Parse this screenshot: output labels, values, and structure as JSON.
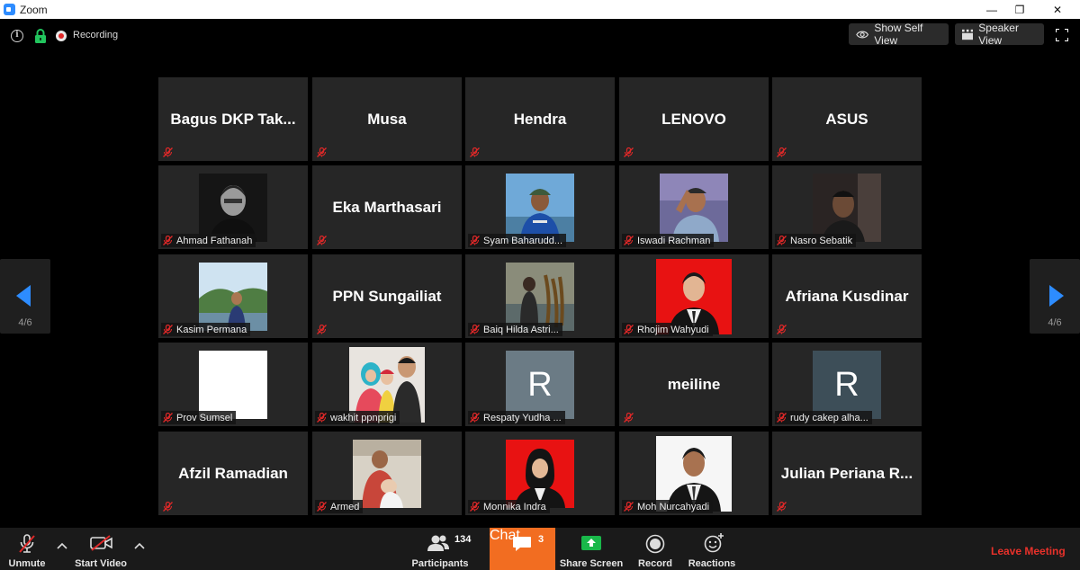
{
  "window": {
    "app_title": "Zoom",
    "minimize": "—",
    "maximize": "❐",
    "close": "✕"
  },
  "topbar": {
    "recording_label": "Recording",
    "show_self_view": "Show Self View",
    "speaker_view": "Speaker View"
  },
  "tiles": [
    {
      "name": "Bagus  DKP  Tak...",
      "kind": "text"
    },
    {
      "name": "Musa",
      "kind": "text"
    },
    {
      "name": "Hendra",
      "kind": "text"
    },
    {
      "name": "LENOVO",
      "kind": "text"
    },
    {
      "name": "ASUS",
      "kind": "text"
    },
    {
      "name": "Ahmad Fathanah",
      "kind": "photo"
    },
    {
      "name": "Eka Marthasari",
      "kind": "text"
    },
    {
      "name": "Syam Baharudd...",
      "kind": "photo"
    },
    {
      "name": "Iswadi Rachman",
      "kind": "photo"
    },
    {
      "name": "Nasro Sebatik",
      "kind": "photo"
    },
    {
      "name": "Kasim Permana",
      "kind": "photo"
    },
    {
      "name": "PPN Sungailiat",
      "kind": "text"
    },
    {
      "name": "Baiq Hilda Astri...",
      "kind": "photo"
    },
    {
      "name": "Rhojim Wahyudi",
      "kind": "photo"
    },
    {
      "name": "Afriana Kusdinar",
      "kind": "text"
    },
    {
      "name": "Prov Sumsel",
      "kind": "photo"
    },
    {
      "name": "wakhit ppnprigi",
      "kind": "photo"
    },
    {
      "name": "Respaty Yudha ...",
      "kind": "avatar",
      "letter": "R"
    },
    {
      "name": "meiline",
      "kind": "text"
    },
    {
      "name": "rudy cakep alha...",
      "kind": "avatar",
      "letter": "R"
    },
    {
      "name": "Afzil Ramadian",
      "kind": "text"
    },
    {
      "name": "Armed",
      "kind": "photo"
    },
    {
      "name": "Monnika Indra",
      "kind": "photo"
    },
    {
      "name": "Moh Nurcahyadi",
      "kind": "photo"
    },
    {
      "name": "Julian  Periana  R...",
      "kind": "text"
    }
  ],
  "pager": {
    "left": "4/6",
    "right": "4/6"
  },
  "toolbar": {
    "unmute": "Unmute",
    "start_video": "Start Video",
    "participants": "Participants",
    "participants_count": "134",
    "chat": "Chat",
    "chat_count": "3",
    "share_screen": "Share Screen",
    "record": "Record",
    "reactions": "Reactions",
    "leave": "Leave Meeting"
  },
  "colors": {
    "accent_chat": "#f26d21",
    "leave": "#e8312a",
    "nav_arrow": "#2d8cff",
    "share_green": "#19b84a"
  }
}
